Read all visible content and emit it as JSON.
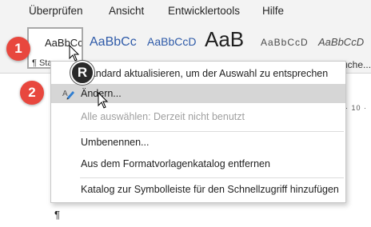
{
  "ribbon_tabs": [
    "Überprüfen",
    "Ansicht",
    "Entwicklertools",
    "Hilfe"
  ],
  "styles_gallery": {
    "tiles": [
      {
        "sample": "AaBbCcDc",
        "label": "¶ Sta"
      },
      {
        "sample": "AaBbCc"
      },
      {
        "sample": "AaBbCcD"
      },
      {
        "sample": "AaB"
      },
      {
        "sample": "AaBbCcD"
      },
      {
        "sample": "AaBbCcD"
      }
    ],
    "right_label": "uche..."
  },
  "context_menu": {
    "items": [
      {
        "label": "Standard aktualisieren, um der Auswahl zu entsprechen",
        "enabled": true
      },
      {
        "label": "Ändern...",
        "enabled": true,
        "hovered": true,
        "icon": "pencil-icon"
      },
      {
        "label": "Alle auswählen: Derzeit nicht benutzt",
        "enabled": false
      },
      {
        "label": "Umbenennen...",
        "enabled": true
      },
      {
        "label": "Aus dem Formatvorlagenkatalog entfernen",
        "enabled": true
      },
      {
        "label": "Katalog zur Symbolleiste für den Schnellzugriff hinzufügen",
        "enabled": true
      }
    ]
  },
  "annotations": {
    "step1": "1",
    "step2": "2",
    "badge": "R"
  },
  "document": {
    "pilcrow": "¶",
    "ruler_fragment": "· 10 ·"
  },
  "colors": {
    "ribbon_bg": "#f3f3f3",
    "menu_hover": "#d6d6d6",
    "step_marker": "#e8473e",
    "style_blue": "#2e5aa8"
  }
}
